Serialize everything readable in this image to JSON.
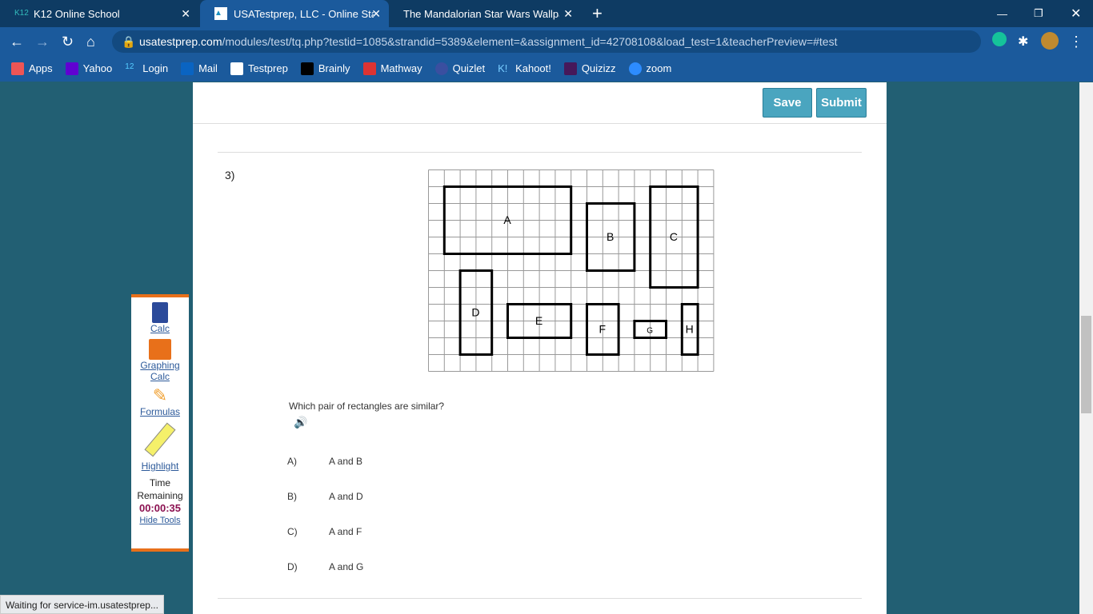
{
  "tabs": [
    {
      "label": "K12 Online School"
    },
    {
      "label": "USATestprep, LLC - Online State-S"
    },
    {
      "label": "The Mandalorian Star Wars Wallpaper"
    }
  ],
  "url": {
    "host": "usatestprep.com",
    "path": "/modules/test/tq.php?testid=1085&strandid=5389&element=&assignment_id=42708108&load_test=1&teacherPreview=#test"
  },
  "bookmarks": [
    "Apps",
    "Yahoo",
    "Login",
    "Mail",
    "Testprep",
    "Brainly",
    "Mathway",
    "Quizlet",
    "Kahoot!",
    "Quizizz",
    "zoom"
  ],
  "header": {
    "save": "Save",
    "submit": "Submit"
  },
  "question": {
    "number": "3)",
    "prompt": "Which pair of rectangles are similar?",
    "answers": [
      {
        "letter": "A)",
        "text": "A and B"
      },
      {
        "letter": "B)",
        "text": "A and D"
      },
      {
        "letter": "C)",
        "text": "A and F"
      },
      {
        "letter": "D)",
        "text": "A and G"
      }
    ],
    "figure": {
      "cols": 18,
      "rows": 12,
      "rects": [
        {
          "label": "A",
          "c": 1,
          "r": 1,
          "w": 8,
          "h": 4
        },
        {
          "label": "B",
          "c": 10,
          "r": 2,
          "w": 3,
          "h": 4
        },
        {
          "label": "C",
          "c": 14,
          "r": 1,
          "w": 3,
          "h": 6
        },
        {
          "label": "D",
          "c": 2,
          "r": 6,
          "w": 2,
          "h": 5
        },
        {
          "label": "E",
          "c": 5,
          "r": 8,
          "w": 4,
          "h": 2
        },
        {
          "label": "F",
          "c": 10,
          "r": 8,
          "w": 2,
          "h": 3
        },
        {
          "label": "G",
          "c": 13,
          "r": 9,
          "w": 2,
          "h": 1
        },
        {
          "label": "H",
          "c": 16,
          "r": 8,
          "w": 1,
          "h": 3
        }
      ]
    }
  },
  "tools": {
    "calc": "Calc",
    "graphing": "Graphing Calc",
    "formulas": "Formulas",
    "highlight": "Highlight",
    "time_label": "Time Remaining",
    "time": "00:00:35",
    "hide": "Hide Tools"
  },
  "status": "Waiting for service-im.usatestprep..."
}
